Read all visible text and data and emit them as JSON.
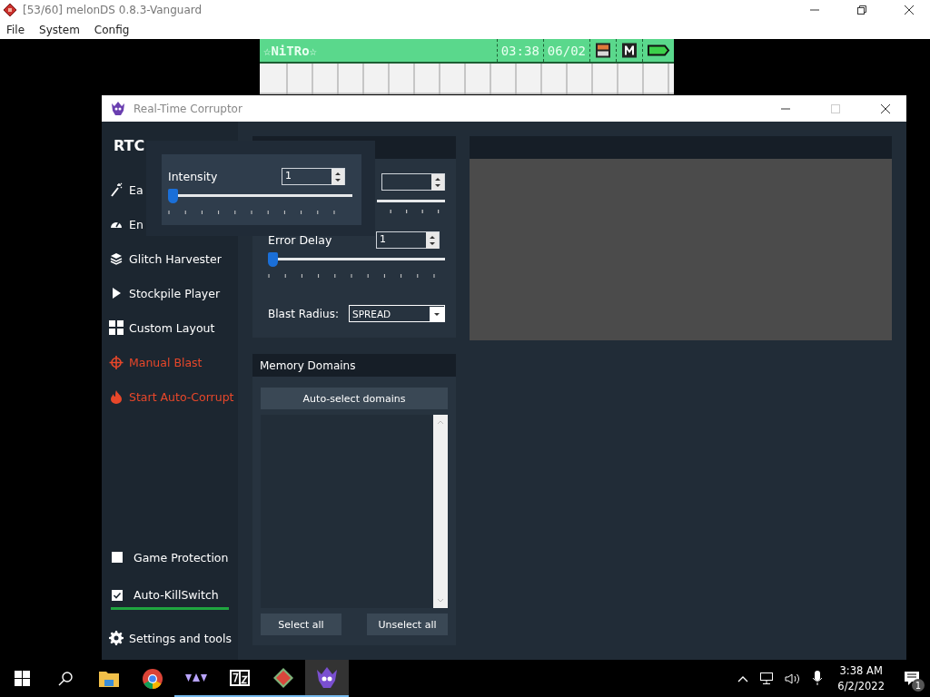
{
  "emulator_window": {
    "title": "[53/60] melonDS 0.8.3-Vanguard",
    "menu": [
      "File",
      "System",
      "Config"
    ],
    "top_screen": {
      "user_name": "☆NiTRo☆",
      "time": "03:38",
      "date": "06/02"
    }
  },
  "rtc_window": {
    "title": "Real-Time Corruptor",
    "brand": "RTC",
    "sidebar": [
      {
        "label": "Ea",
        "kind": "nav"
      },
      {
        "label": "En",
        "kind": "nav"
      },
      {
        "label": "Glitch Harvester",
        "kind": "nav"
      },
      {
        "label": "Stockpile Player",
        "kind": "nav"
      },
      {
        "label": "Custom Layout",
        "kind": "nav"
      },
      {
        "label": "Manual Blast",
        "kind": "action"
      },
      {
        "label": "Start Auto-Corrupt",
        "kind": "action"
      }
    ],
    "options": [
      {
        "label": "Game Protection",
        "checked": false
      },
      {
        "label": "Auto-KillSwitch",
        "checked": true
      }
    ],
    "settings": "Settings and tools",
    "engine": {
      "error_delay": {
        "label": "Error Delay",
        "value": "1",
        "level": 0
      },
      "blast_radius": {
        "label": "Blast Radius:",
        "value": "SPREAD"
      }
    },
    "intensity_popup": {
      "label": "Intensity",
      "value": "1",
      "level": 0
    },
    "memory_domains": {
      "title": "Memory Domains",
      "auto_button": "Auto-select domains",
      "buttons": [
        "Select all",
        "Unselect all"
      ]
    }
  },
  "taskbar": {
    "time": "3:38 AM",
    "date": "6/2/2022",
    "notifications": "1"
  }
}
